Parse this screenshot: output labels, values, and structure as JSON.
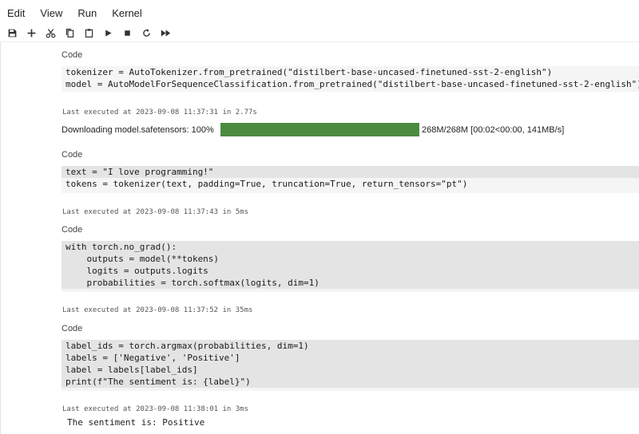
{
  "menu": [
    "Edit",
    "View",
    "Run",
    "Kernel"
  ],
  "toolbar": [
    "save-icon",
    "add-icon",
    "cut-icon",
    "copy-icon",
    "paste-icon",
    "run-icon",
    "stop-icon",
    "restart-icon",
    "run-all-icon"
  ],
  "cells": [
    {
      "label": "Code",
      "lines": [
        "tokenizer = AutoTokenizer.from_pretrained(\"distilbert-base-uncased-finetuned-sst-2-english\")",
        "model = AutoModelForSequenceClassification.from_pretrained(\"distilbert-base-uncased-finetuned-sst-2-english\")"
      ],
      "exec": "Last executed at 2023-09-08 11:37:31 in 2.77s",
      "output": {
        "prefix": "Downloading model.safetensors: 100%",
        "progress": 1.0,
        "suffix": "268M/268M [00:02<00:00, 141MB/s]"
      }
    },
    {
      "label": "Code",
      "lines": [
        "text = \"I love programming!\"",
        "tokens = tokenizer(text, padding=True, truncation=True, return_tensors=\"pt\")"
      ],
      "exec": "Last executed at 2023-09-08 11:37:43 in 5ms"
    },
    {
      "label": "Code",
      "lines": [
        "with torch.no_grad():",
        "    outputs = model(**tokens)",
        "    logits = outputs.logits",
        "    probabilities = torch.softmax(logits, dim=1)"
      ],
      "exec": "Last executed at 2023-09-08 11:37:52 in 35ms"
    },
    {
      "label": "Code",
      "lines": [
        "label_ids = torch.argmax(probabilities, dim=1)",
        "labels = ['Negative', 'Positive']",
        "label = labels[label_ids]",
        "print(f\"The sentiment is: {label}\")"
      ],
      "exec": "Last executed at 2023-09-08 11:38:01 in 3ms",
      "output": "The sentiment is: Positive"
    }
  ],
  "colors": {
    "progress": "#4a8b3f",
    "code_bg": "#f5f5f5",
    "keyword": "#7b3db0",
    "string": "#b8263a",
    "number": "#2e7d32"
  }
}
